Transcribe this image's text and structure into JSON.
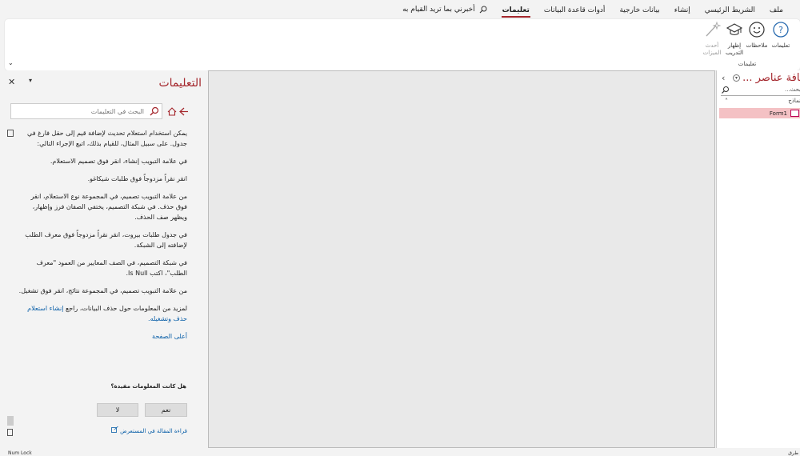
{
  "tabs": [
    {
      "label": "ملف"
    },
    {
      "label": "الشريط الرئيسي"
    },
    {
      "label": "إنشاء"
    },
    {
      "label": "بيانات خارجية"
    },
    {
      "label": "أدوات قاعدة البيانات"
    },
    {
      "label": "تعليمات",
      "active": true
    }
  ],
  "tell_me": {
    "placeholder": "أخبرني بما تريد القيام به",
    "icon": "search-icon"
  },
  "ribbon": {
    "buttons": [
      {
        "name": "help-button",
        "label": "تعليمات",
        "icon": "question-circle-icon"
      },
      {
        "name": "feedback-button",
        "label": "ملاحظات",
        "icon": "smiley-icon"
      },
      {
        "name": "training-button",
        "label": "إظهار التدريب",
        "icon": "graduation-cap-icon"
      },
      {
        "name": "whats-new-button",
        "label": "أحدث الميزات",
        "icon": "magic-wand-icon",
        "disabled": true
      }
    ],
    "group_label": "تعليمات"
  },
  "nav_pane": {
    "title": "كافة عناصر ...",
    "search_placeholder": "بحث...",
    "group": "نماذج",
    "items": [
      {
        "label": "Form1",
        "icon": "form-icon"
      }
    ]
  },
  "help": {
    "title": "التعليمات",
    "search_placeholder": "البحث في التعليمات",
    "paragraphs": [
      "يمكن استخدام استعلام تحديث لإضافة قيم إلى حقل فارغ في جدول. على سبيل المثال، للقيام بذلك، اتبع الإجراء التالي:",
      "في علامة التبويب إنشاء، انقر فوق تصميم الاستعلام.",
      "انقر نقراً مزدوجاً فوق طلبات شيكاغو.",
      "من علامة التبويب تصميم، في المجموعة نوع الاستعلام، انقر فوق حذف. في شبكة التصميم، يختفي الصفان فرز وإظهار، ويظهر صف الحذف.",
      "في جدول طلبات بيروت، انقر نقراً مزدوجاً فوق معرف الطلب لإضافته إلى الشبكة.",
      "في شبكة التصميم، في الصف المعايير من العمود \"معرف الطلب\"، اكتب Is Null.",
      "من علامة التبويب تصميم، في المجموعة نتائج، انقر فوق تشغيل."
    ],
    "more_prefix": "لمزيد من المعلومات حول حذف البيانات، راجع ",
    "more_link": "إنشاء استعلام حذف وتشغيله.",
    "back_to_top": "أعلى الصفحة",
    "helpful_question": "هل كانت المعلومات مفيدة؟",
    "yes_label": "نعم",
    "no_label": "لا",
    "feedback_link": "قراءة المقالة في المستعرض"
  },
  "status": {
    "left": "Num Lock",
    "right": "طرق"
  }
}
